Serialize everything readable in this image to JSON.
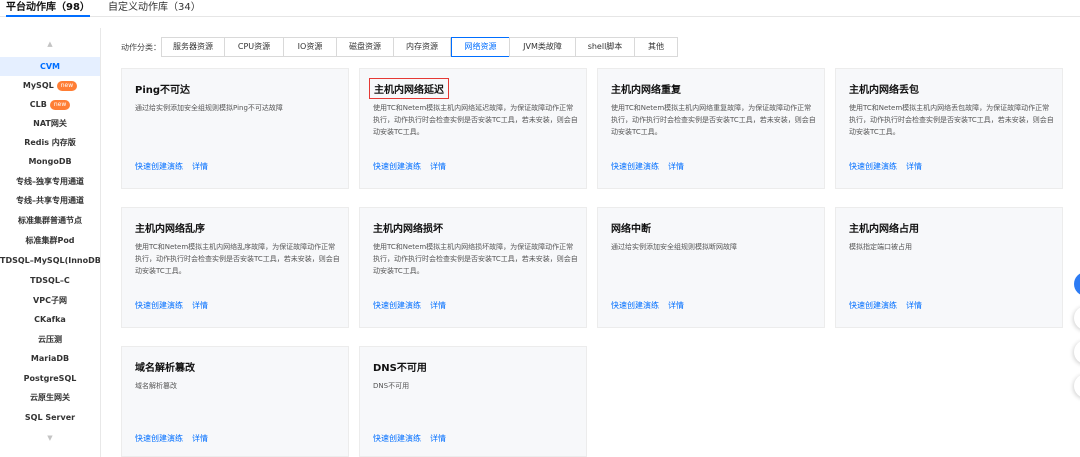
{
  "top_tabs": [
    {
      "label": "平台动作库（98）"
    },
    {
      "label": "自定义动作库（34）"
    }
  ],
  "sidebar": {
    "scroll_up_icon": "chevron-up-icon",
    "scroll_down_icon": "chevron-down-icon",
    "items": [
      {
        "label": "CVM"
      },
      {
        "label": "MySQL"
      },
      {
        "label": "CLB"
      },
      {
        "label": "NAT网关"
      },
      {
        "label": "Redis 内存版"
      },
      {
        "label": "MongoDB"
      },
      {
        "label": "专线–独享专用通道"
      },
      {
        "label": "专线–共享专用通道"
      },
      {
        "label": "标准集群普通节点"
      },
      {
        "label": "标准集群Pod"
      },
      {
        "label": "TDSQL–MySQL(InnoDB)"
      },
      {
        "label": "TDSQL–C"
      },
      {
        "label": "VPC子网"
      },
      {
        "label": "CKafka"
      },
      {
        "label": "云压测"
      },
      {
        "label": "MariaDB"
      },
      {
        "label": "PostgreSQL"
      },
      {
        "label": "云原生网关"
      },
      {
        "label": "SQL Server"
      }
    ],
    "badge_label": "new",
    "badge_color": "#ff7e35"
  },
  "filter": {
    "label": "动作分类：",
    "options": [
      "服务器资源",
      "CPU资源",
      "IO资源",
      "磁盘资源",
      "内存资源",
      "网络资源",
      "JVM类故障",
      "shell脚本",
      "其他"
    ],
    "selected": "网络资源"
  },
  "card_link_labels": {
    "quick": "快速创建演练",
    "detail": "详情"
  },
  "cards": [
    {
      "title": "Ping不可达",
      "desc": "通过给实例添加安全组规则模拟Ping不可达故障"
    },
    {
      "title": "主机内网络延迟",
      "desc": "使用TC和Netem模拟主机内网络延迟故障，为保证故障动作正常执行，动作执行时会检查实例是否安装TC工具，若未安装，则会自动安装TC工具。"
    },
    {
      "title": "主机内网络重复",
      "desc": "使用TC和Netem模拟主机内网络重复故障，为保证故障动作正常执行，动作执行时会检查实例是否安装TC工具，若未安装，则会自动安装TC工具。"
    },
    {
      "title": "主机内网络丢包",
      "desc": "使用TC和Netem模拟主机内网络丢包故障，为保证故障动作正常执行，动作执行时会检查实例是否安装TC工具，若未安装，则会自动安装TC工具。"
    },
    {
      "title": "主机内网络乱序",
      "desc": "使用TC和Netem模拟主机内网络乱序故障，为保证故障动作正常执行，动作执行时会检查实例是否安装TC工具，若未安装，则会自动安装TC工具。"
    },
    {
      "title": "主机内网络损坏",
      "desc": "使用TC和Netem模拟主机内网络损坏故障，为保证故障动作正常执行，动作执行时会检查实例是否安装TC工具，若未安装，则会自动安装TC工具。"
    },
    {
      "title": "网络中断",
      "desc": "通过给实例添加安全组规则模拟断网故障"
    },
    {
      "title": "主机内网络占用",
      "desc": "模拟指定端口被占用"
    },
    {
      "title": "域名解析篡改",
      "desc": "域名解析篡改"
    },
    {
      "title": "DNS不可用",
      "desc": "DNS不可用"
    }
  ],
  "colors": {
    "accent": "#006eff",
    "highlight_box": "#e53935"
  }
}
